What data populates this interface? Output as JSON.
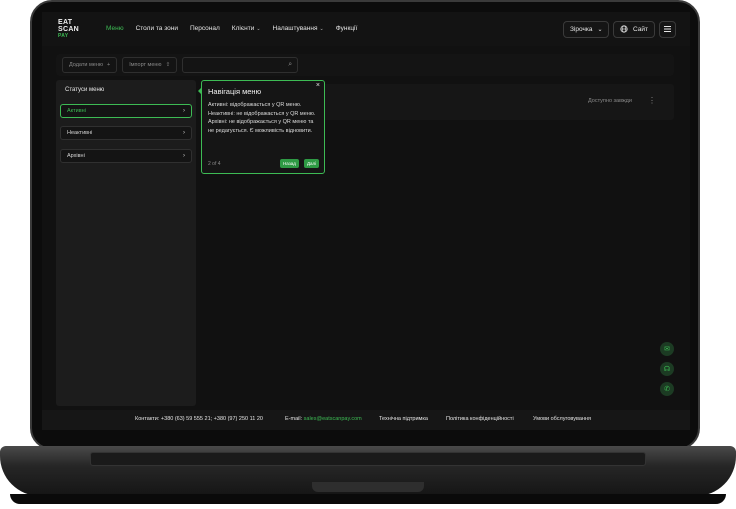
{
  "logo": {
    "line1": "EAT",
    "line2": "SCAN",
    "line3": "PAY"
  },
  "nav": {
    "items": [
      "Меню",
      "Столи та зони",
      "Персонал",
      "Клієнти",
      "Налаштування",
      "Функції"
    ],
    "active_index": 0
  },
  "header_right": {
    "venue": "Зірочка",
    "site": "Сайт"
  },
  "toolbar": {
    "add_menu": "Додати меню",
    "import_menu": "Імпорт меню",
    "search_placeholder": ""
  },
  "sidebar": {
    "title": "Статуси меню",
    "items": [
      {
        "label": "Активні",
        "active": true
      },
      {
        "label": "Неактивні",
        "active": false
      },
      {
        "label": "Архівні",
        "active": false
      }
    ]
  },
  "card": {
    "availability": "Доступно завжди"
  },
  "tooltip": {
    "title": "Навігація меню",
    "body_line1": "Активні: відображається у QR меню.",
    "body_line2": "Неактивні: не відображається у QR меню.",
    "body_line3": "Архівні: не відображається у QR меню та не редагується. Є можливість відновити.",
    "step": "2 of 4",
    "back": "Назад",
    "next": "Далі"
  },
  "footer": {
    "contacts": "Контакти: +380 (63) 59 555 21; +380 (97) 250 11 20",
    "email_label": "E-mail:",
    "email": "sales@eatscanpay.com",
    "support": "Технічна підтримка",
    "privacy": "Політика конфіденційності",
    "terms": "Умови обслуговування"
  },
  "colors": {
    "accent": "#3dbb54",
    "background": "#111111"
  }
}
